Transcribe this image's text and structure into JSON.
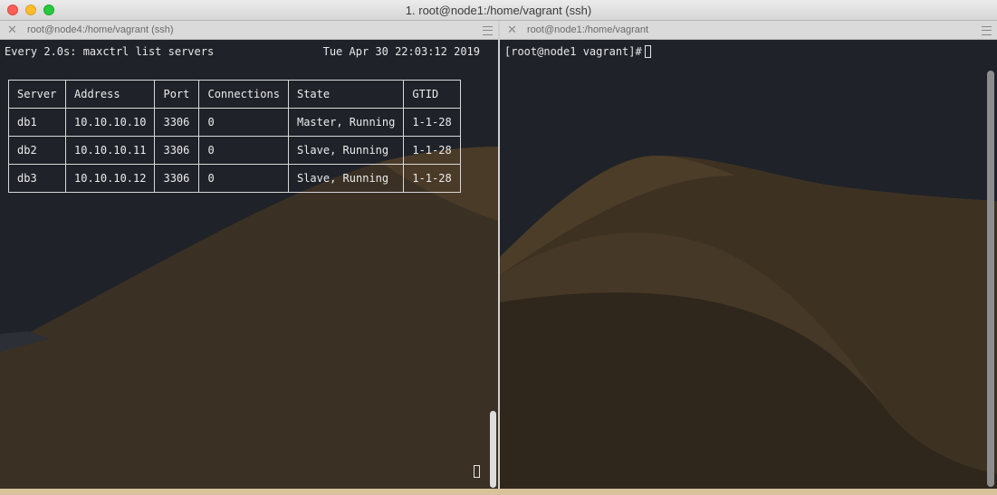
{
  "window": {
    "title": "1. root@node1:/home/vagrant (ssh)"
  },
  "colors": {
    "terminal_bg": "#1f2229",
    "dune": "#4a3a25",
    "text": "#e8e8e8"
  },
  "left_pane": {
    "tab_title": "root@node4:/home/vagrant (ssh)",
    "watch_command": "Every 2.0s: maxctrl list servers",
    "timestamp": "Tue Apr 30 22:03:12 2019",
    "table": {
      "headers": [
        "Server",
        "Address",
        "Port",
        "Connections",
        "State",
        "GTID"
      ],
      "rows": [
        [
          "db1",
          "10.10.10.10",
          "3306",
          "0",
          "Master, Running",
          "1-1-28"
        ],
        [
          "db2",
          "10.10.10.11",
          "3306",
          "0",
          "Slave, Running",
          "1-1-28"
        ],
        [
          "db3",
          "10.10.10.12",
          "3306",
          "0",
          "Slave, Running",
          "1-1-28"
        ]
      ]
    }
  },
  "right_pane": {
    "tab_title": "root@node1:/home/vagrant",
    "prompt": "[root@node1 vagrant]# "
  },
  "icons": {
    "close_tab": "close-icon",
    "pane_menu": "hamburger-icon"
  }
}
